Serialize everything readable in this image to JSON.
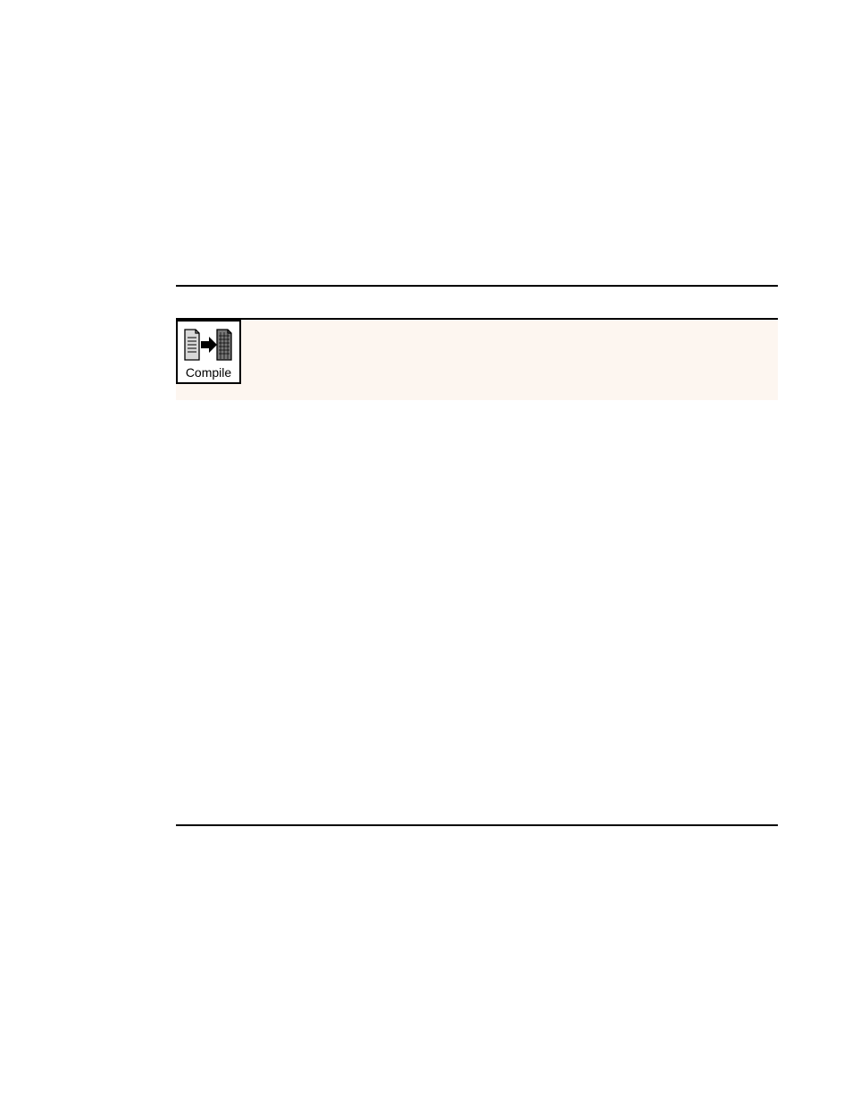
{
  "section": {
    "compile": {
      "label": "Compile",
      "icon_name": "compile-icon"
    }
  }
}
